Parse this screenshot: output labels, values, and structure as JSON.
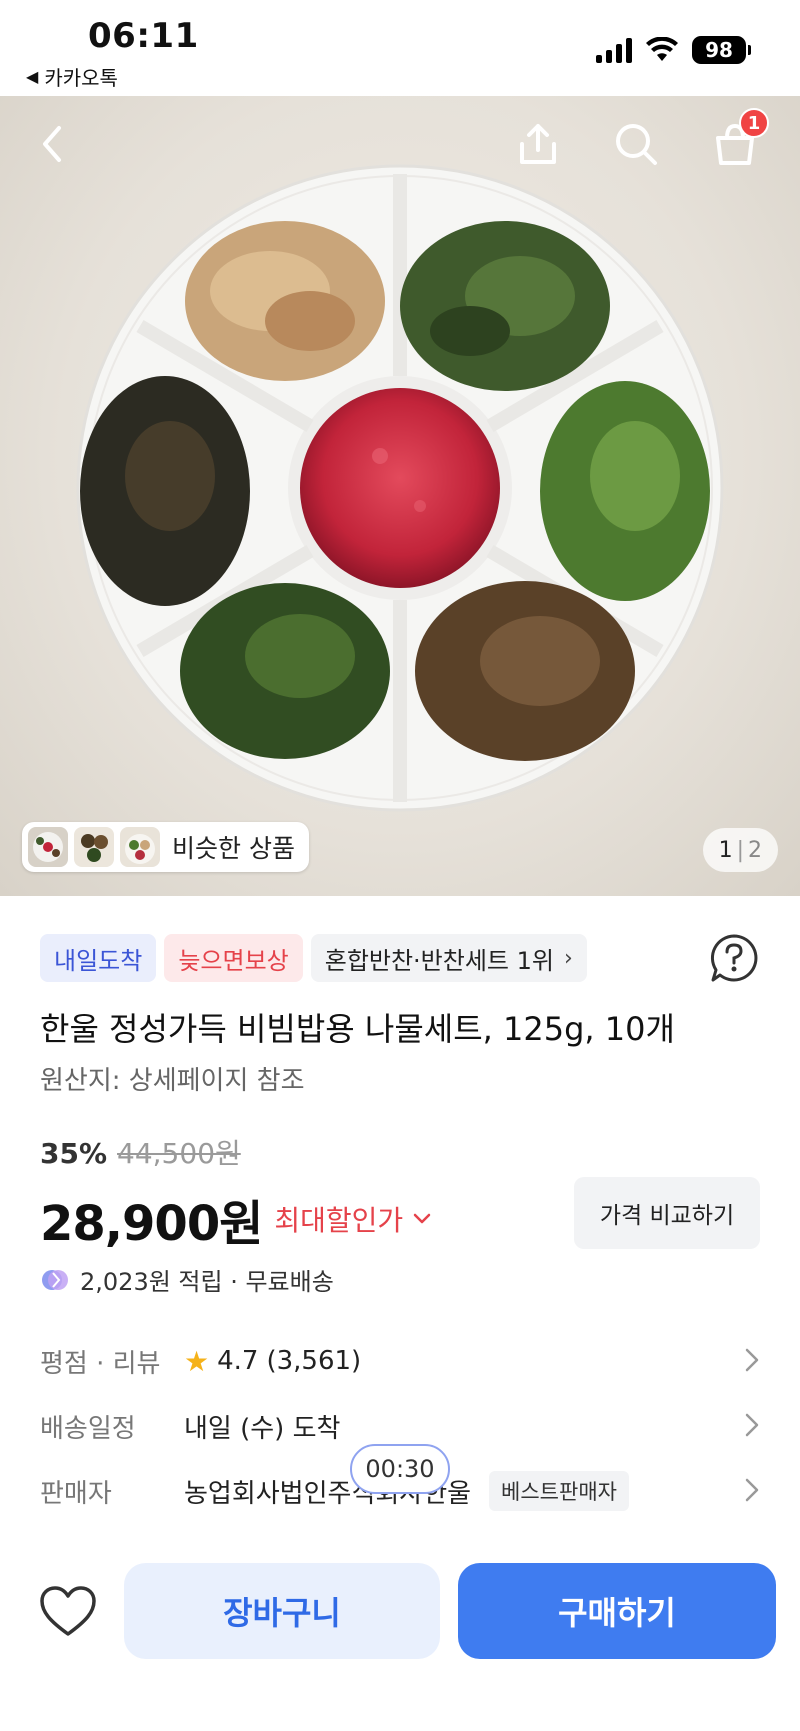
{
  "status_bar": {
    "time": "06:11",
    "back_app": "카카오톡",
    "battery": "98",
    "signal_icon": "cellular-signal-icon",
    "wifi_icon": "wifi-icon"
  },
  "nav": {
    "back_icon": "chevron-left-icon",
    "share_icon": "share-icon",
    "search_icon": "search-icon",
    "cart_icon": "shopping-bag-icon",
    "cart_count": "1"
  },
  "gallery": {
    "similar_label": "비슷한 상품",
    "current_page": "1",
    "total_pages": "2"
  },
  "product": {
    "badges": [
      {
        "label": "내일도착",
        "style": "blue"
      },
      {
        "label": "늦으면보상",
        "style": "red"
      },
      {
        "label": "혼합반찬·반찬세트 1위",
        "style": "gray"
      }
    ],
    "title": "한울 정성가득 비빔밥용 나물세트, 125g, 10개",
    "origin": "원산지: 상세페이지 참조",
    "discount_rate": "35%",
    "original_price": "44,500원",
    "price": "28,900원",
    "max_discount_label": "최대할인가",
    "compare_label": "가격 비교하기",
    "points": "2,023원 적립 · 무료배송"
  },
  "info": {
    "rating_label": "평점 · 리뷰",
    "rating": "4.7",
    "review_count": "(3,561)",
    "delivery_label": "배송일정",
    "delivery_value": "내일 (수) 도착",
    "seller_label": "판매자",
    "seller_value": "농업회사법인주식회사한울",
    "seller_badge": "베스트판매자"
  },
  "timer": "00:30",
  "bottom": {
    "cart_label": "장바구니",
    "buy_label": "구매하기"
  },
  "colors": {
    "accent_blue": "#3f7cf0",
    "sale_red": "#e5424a",
    "badge_blue_text": "#3b55d6"
  }
}
